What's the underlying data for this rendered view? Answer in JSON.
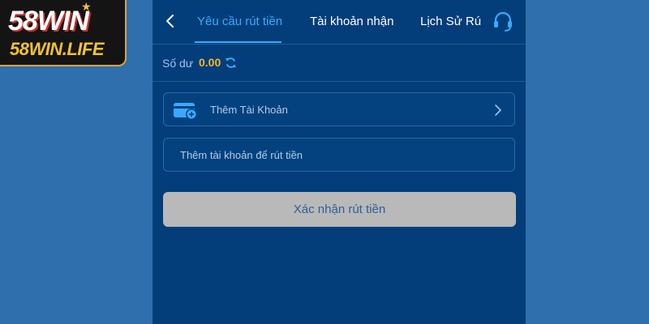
{
  "logo": {
    "line1": "58WIN",
    "line2": "58WIN.LIFE"
  },
  "tabs": [
    {
      "label": "Yêu cầu rút tiền",
      "active": true
    },
    {
      "label": "Tài khoản nhận",
      "active": false
    },
    {
      "label": "Lịch Sử Rú",
      "active": false
    }
  ],
  "balance": {
    "label": "Số dư",
    "value": "0.00"
  },
  "add_account": {
    "label": "Thêm Tài Khoản"
  },
  "account_field": {
    "placeholder": "Thêm tài khoản để rút tiền"
  },
  "confirm_button": {
    "label": "Xác nhận rút tiền"
  },
  "colors": {
    "accent": "#3aa9ff",
    "balance": "#f6b526",
    "panel": "#033e7a",
    "page": "#2f6fae"
  },
  "icons": [
    "back-arrow-icon",
    "headset-icon",
    "refresh-icon",
    "wallet-add-icon",
    "chevron-right-icon"
  ]
}
